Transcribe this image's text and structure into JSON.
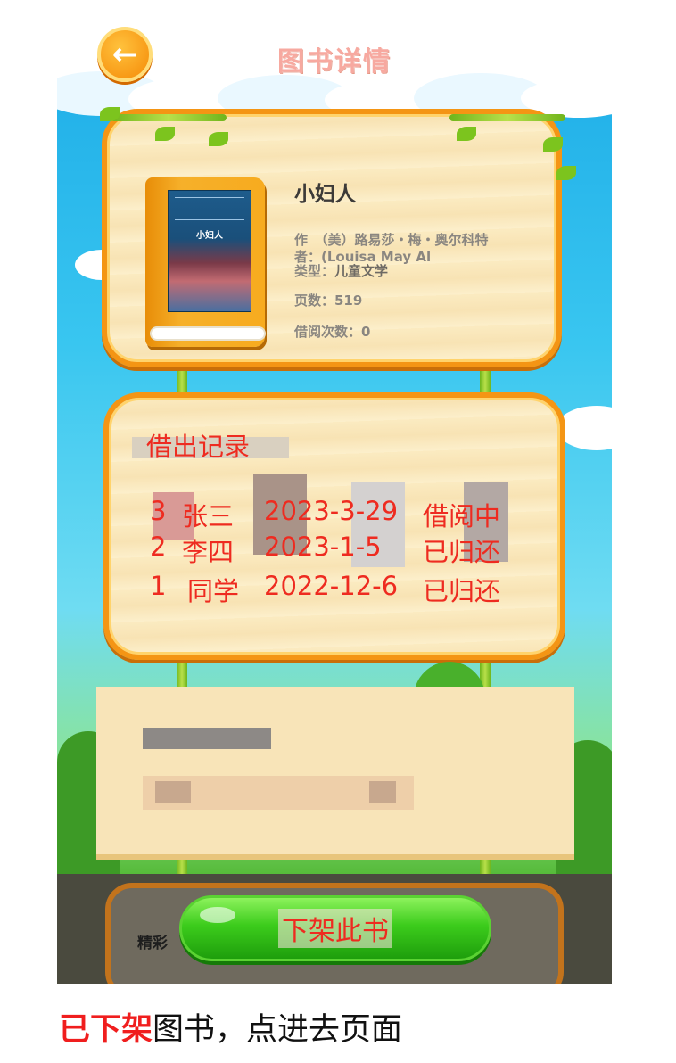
{
  "header": {
    "title": "图书详情",
    "back_icon": "←"
  },
  "book": {
    "name": "小妇人",
    "cover_text": "小妇人",
    "author_line1": "作　（美）路易莎・梅・奥尔科特",
    "author_line2": "者：(Louisa May Al",
    "type_label": "类型：",
    "type_value": "儿童文学",
    "pages": "页数：519",
    "borrow_count": "借阅次数：0"
  },
  "record": {
    "title": "借出记录",
    "rows": [
      {
        "no": "3",
        "name": "张三",
        "date": "2023-3-29",
        "status": "借阅中"
      },
      {
        "no": "2",
        "name": "李四",
        "date": "2023-1-5",
        "status": "已归还"
      },
      {
        "no": "1",
        "name": "同学",
        "date": "2022-12-6",
        "status": "已归还"
      }
    ]
  },
  "bottom_panel": {
    "label": "精彩"
  },
  "action": {
    "off_shelf_label": "下架此书"
  },
  "caption": {
    "highlight": "已下架",
    "rest": "图书，点进去页面"
  },
  "colors": {
    "accent_red": "#ee2b20",
    "panel_border": "#f49514",
    "button_green": "#3ccc1c"
  }
}
